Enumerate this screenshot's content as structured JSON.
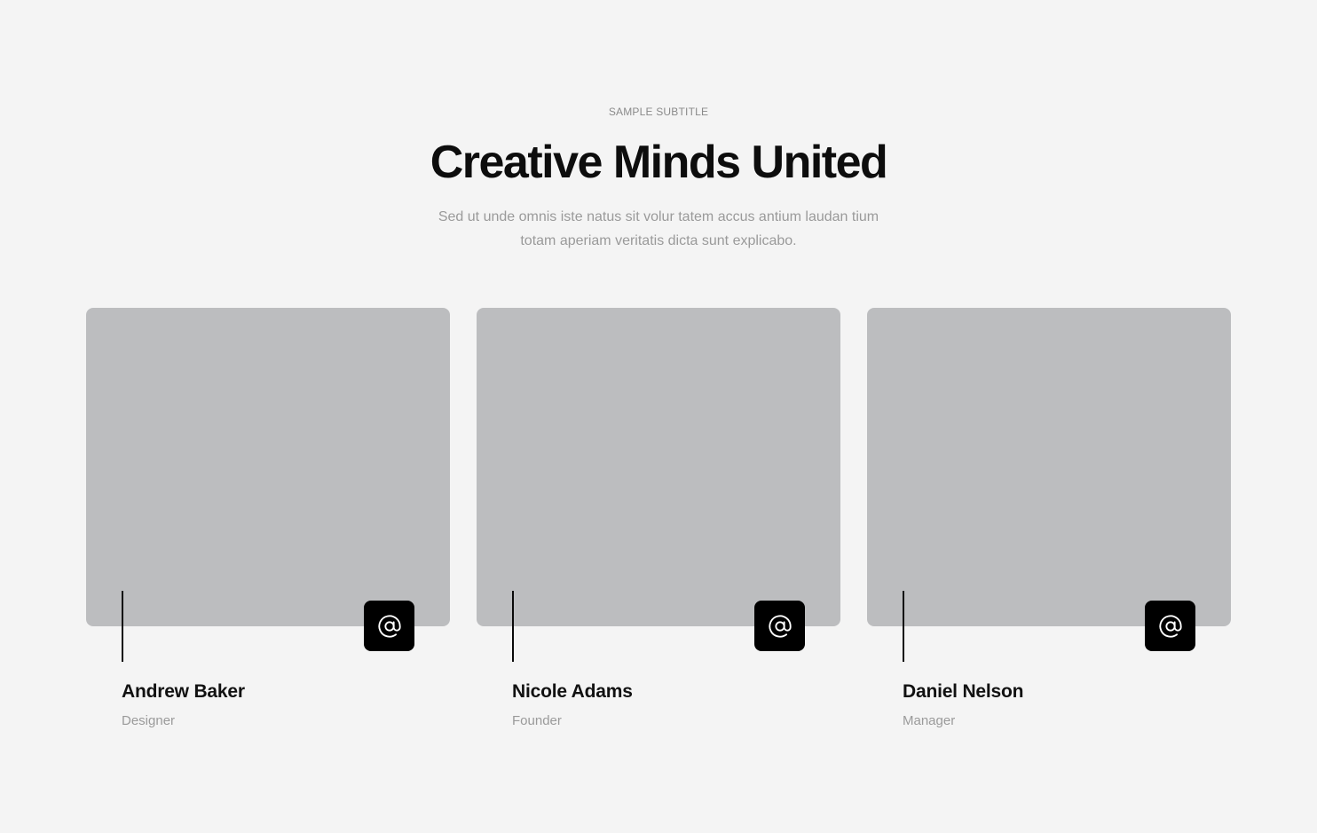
{
  "section": {
    "subtitle": "SAMPLE SUBTITLE",
    "title": "Creative Minds United",
    "description_line1": "Sed ut unde omnis iste natus sit volur tatem accus antium laudan tium",
    "description_line2": "totam aperiam veritatis dicta sunt explicabo."
  },
  "team": [
    {
      "name": "Andrew Baker",
      "role": "Designer",
      "icon": "at-sign-icon"
    },
    {
      "name": "Nicole Adams",
      "role": "Founder",
      "icon": "at-sign-icon"
    },
    {
      "name": "Daniel Nelson",
      "role": "Manager",
      "icon": "at-sign-icon"
    }
  ],
  "colors": {
    "background": "#f4f4f4",
    "image_placeholder": "#bcbdbf",
    "accent": "#000000",
    "muted_text": "#9a9a9a",
    "heading_text": "#0d0d0d"
  }
}
